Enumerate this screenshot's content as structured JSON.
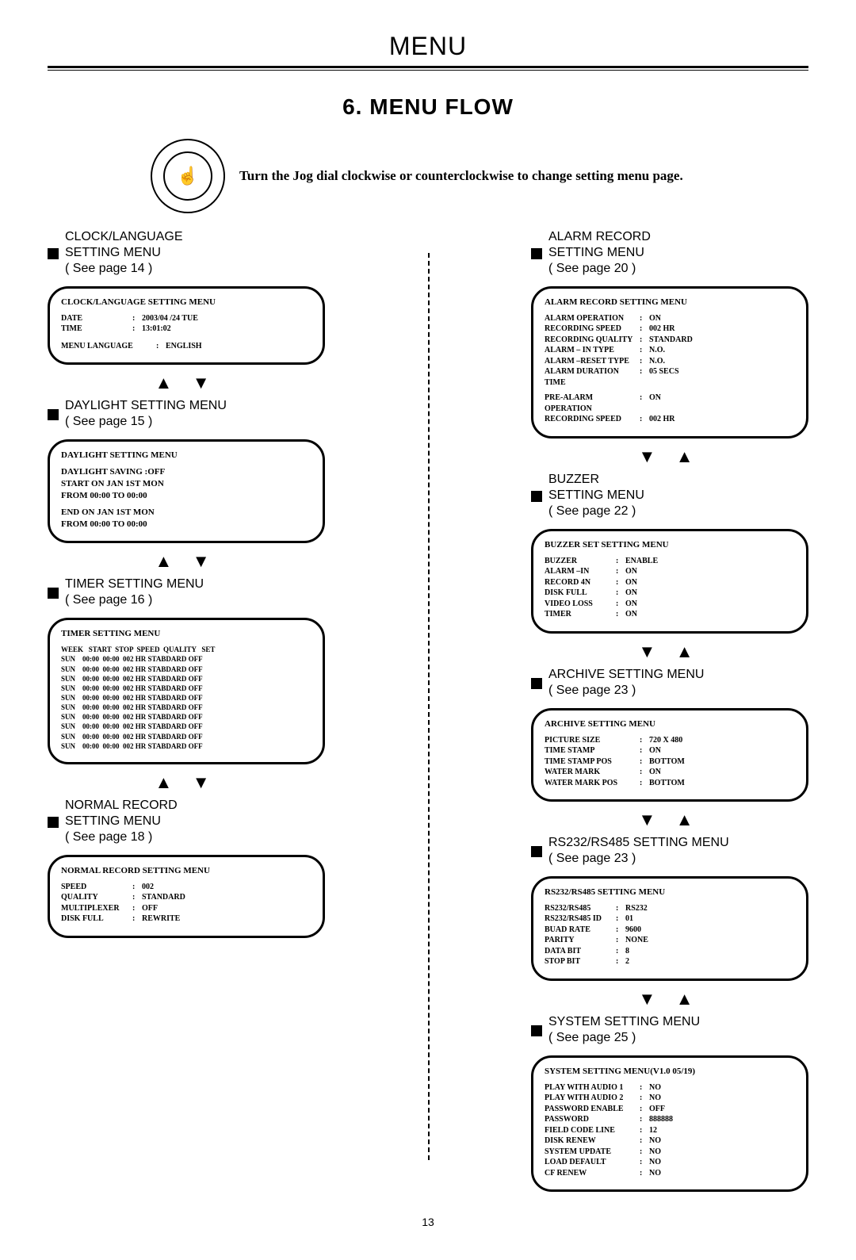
{
  "header": "MENU",
  "section_heading": "6. MENU FLOW",
  "intro_text": "Turn the Jog dial clockwise or counterclockwise to change setting menu page.",
  "page_number": "13",
  "left": {
    "clock": {
      "label": "CLOCK/LANGUAGE\nSETTING MENU\n( See page 14 )",
      "title": "CLOCK/LANGUAGE SETTING MENU",
      "date_k": "DATE",
      "date_v": "2003/04 /24 TUE",
      "time_k": "TIME",
      "time_v": "13:01:02",
      "lang_k": "MENU LANGUAGE",
      "lang_v": "ENGLISH"
    },
    "daylight": {
      "label": "DAYLIGHT SETTING MENU\n( See page 15 )",
      "title": "DAYLIGHT SETTING MENU",
      "l1": "DAYLIGHT SAVING :OFF",
      "l2": "START ON JAN 1ST MON",
      "l3": "FROM 00:00 TO 00:00",
      "l4": "END ON JAN 1ST MON",
      "l5": "FROM 00:00 TO 00:00"
    },
    "timer": {
      "label": "TIMER SETTING MENU\n( See page 16 )",
      "title": "TIMER SETTING MENU",
      "header": "WEEK   START  STOP  SPEED  QUALITY   SET",
      "rows": [
        "SUN    00:00  00:00  002 HR STABDARD OFF",
        "SUN    00:00  00:00  002 HR STABDARD OFF",
        "SUN    00:00  00:00  002 HR STABDARD OFF",
        "SUN    00:00  00:00  002 HR STABDARD OFF",
        "SUN    00:00  00:00  002 HR STABDARD OFF",
        "SUN    00:00  00:00  002 HR STABDARD OFF",
        "SUN    00:00  00:00  002 HR STABDARD OFF",
        "SUN    00:00  00:00  002 HR STABDARD OFF",
        "SUN    00:00  00:00  002 HR STABDARD OFF",
        "SUN    00:00  00:00  002 HR STABDARD OFF"
      ]
    },
    "normal": {
      "label": "NORMAL RECORD\nSETTING MENU\n( See page 18 )",
      "title": "NORMAL RECORD SETTING MENU",
      "kv": [
        [
          "SPEED",
          "002"
        ],
        [
          "QUALITY",
          "STANDARD"
        ],
        [
          "MULTIPLEXER",
          "OFF"
        ],
        [
          "DISK FULL",
          "REWRITE"
        ]
      ]
    }
  },
  "right": {
    "alarm": {
      "label": "ALARM RECORD\nSETTING MENU\n( See page 20 )",
      "title": "ALARM RECORD SETTING MENU",
      "kv": [
        [
          "ALARM  OPERATION",
          "ON"
        ],
        [
          "RECORDING SPEED",
          "002 HR"
        ],
        [
          "RECORDING QUALITY",
          "STANDARD"
        ],
        [
          "ALARM – IN  TYPE",
          "N.O."
        ],
        [
          "ALARM –RESET TYPE",
          "N.O."
        ],
        [
          "ALARM  DURATION TIME",
          "05 SECS"
        ]
      ],
      "kv2": [
        [
          "PRE-ALARM OPERATION",
          "ON"
        ],
        [
          "RECORDING SPEED",
          "002 HR"
        ]
      ]
    },
    "buzzer": {
      "label": "BUZZER\nSETTING MENU\n( See page 22 )",
      "title": "BUZZER SET SETTING MENU",
      "kv": [
        [
          "BUZZER",
          "ENABLE"
        ],
        [
          "ALARM –IN",
          "ON"
        ],
        [
          "RECORD 4N",
          "ON"
        ],
        [
          "DISK FULL",
          "ON"
        ],
        [
          "VIDEO LOSS",
          "ON"
        ],
        [
          "TIMER",
          "ON"
        ]
      ]
    },
    "archive": {
      "label": "ARCHIVE  SETTING MENU\n( See page 23 )",
      "title": "ARCHIVE SETTING MENU",
      "kv": [
        [
          "PICTURE SIZE",
          "720 X 480"
        ],
        [
          "TIME STAMP",
          "ON"
        ],
        [
          "TIME STAMP POS",
          "BOTTOM"
        ],
        [
          "WATER MARK",
          "ON"
        ],
        [
          "WATER MARK POS",
          "BOTTOM"
        ]
      ]
    },
    "serial": {
      "label": "RS232/RS485  SETTING MENU\n( See page 23 )",
      "title": "RS232/RS485 SETTING MENU",
      "kv": [
        [
          "RS232/RS485",
          "RS232"
        ],
        [
          "RS232/RS485 ID",
          "01"
        ],
        [
          "BUAD RATE",
          "9600"
        ],
        [
          "PARITY",
          "NONE"
        ],
        [
          "DATA BIT",
          "8"
        ],
        [
          "STOP BIT",
          "2"
        ]
      ]
    },
    "system": {
      "label": "SYSTEM  SETTING MENU\n( See page 25 )",
      "title": "SYSTEM SETTING MENU(V1.0 05/19)",
      "kv": [
        [
          "PLAY WITH AUDIO 1",
          "NO"
        ],
        [
          "PLAY WITH AUDIO 2",
          "NO"
        ],
        [
          "PASSWORD ENABLE",
          "OFF"
        ],
        [
          "PASSWORD",
          "888888"
        ],
        [
          "FIELD CODE LINE",
          "12"
        ],
        [
          "DISK RENEW",
          "NO"
        ],
        [
          "SYSTEM UPDATE",
          "NO"
        ],
        [
          "LOAD DEFAULT",
          "NO"
        ],
        [
          "CF RENEW",
          "NO"
        ]
      ]
    }
  }
}
